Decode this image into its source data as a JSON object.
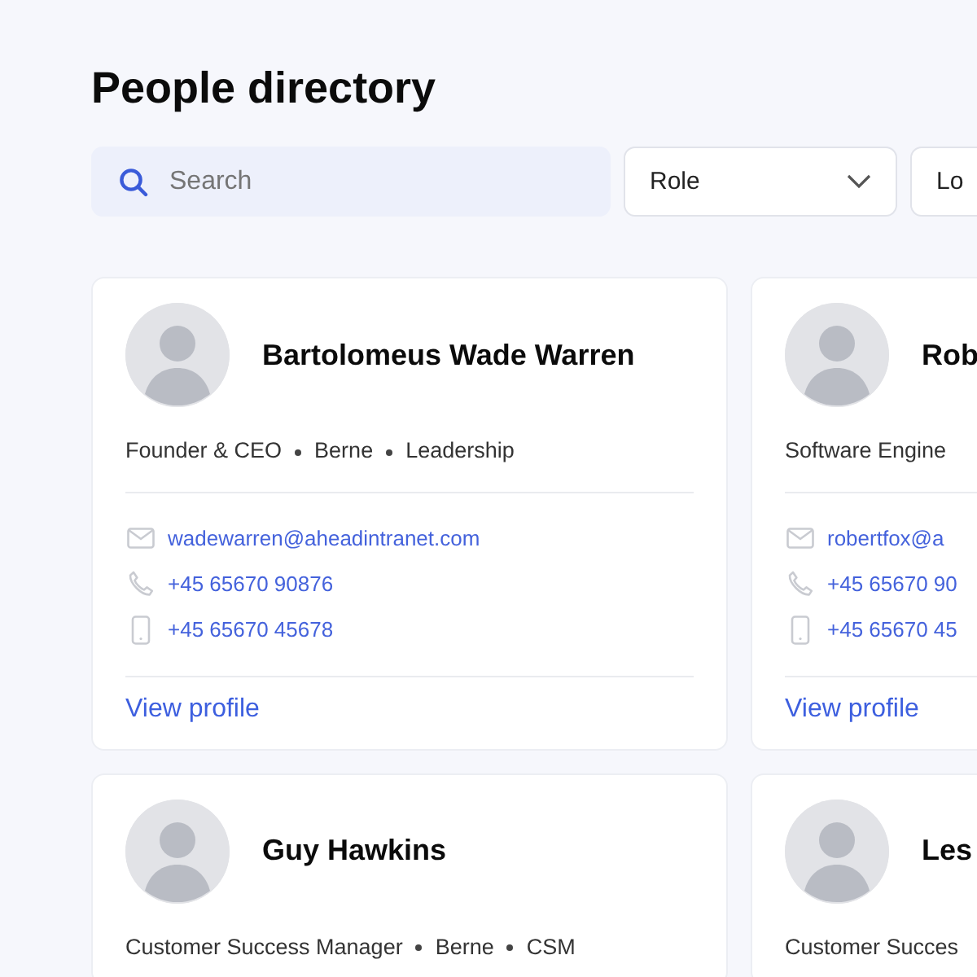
{
  "title": "People directory",
  "search": {
    "placeholder": "Search"
  },
  "filters": [
    {
      "label": "Role"
    },
    {
      "label": "Lo"
    }
  ],
  "people": [
    {
      "name": "Bartolomeus Wade Warren",
      "meta": [
        "Founder & CEO",
        "Berne",
        "Leadership"
      ],
      "email": "wadewarren@aheadintranet.com",
      "phone": "+45 65670 90876",
      "mobile": "+45 65670 45678",
      "link": "View profile"
    },
    {
      "name": "Rob",
      "meta": [
        "Software Engine"
      ],
      "email": "robertfox@a",
      "phone": "+45 65670 90",
      "mobile": "+45 65670 45",
      "link": "View profile"
    },
    {
      "name": "Guy Hawkins",
      "meta": [
        "Customer Success Manager",
        "Berne",
        "CSM"
      ]
    },
    {
      "name": "Les",
      "meta": [
        "Customer Succes"
      ]
    }
  ]
}
